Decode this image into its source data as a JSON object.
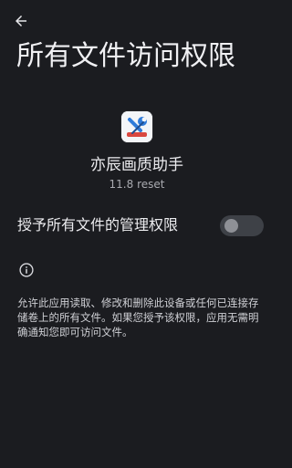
{
  "header": {
    "back_icon": "arrow-back-icon",
    "title": "所有文件访问权限"
  },
  "app": {
    "icon": "wrench-app-icon",
    "name": "亦辰画质助手",
    "version": "11.8 reset"
  },
  "permission": {
    "label": "授予所有文件的管理权限",
    "enabled": false
  },
  "info": {
    "icon": "info-icon",
    "description": "允许此应用读取、修改和删除此设备或任何已连接存储卷上的所有文件。如果您授予该权限，应用无需明确通知您即可访问文件。"
  },
  "colors": {
    "background": "#1b1c20",
    "text_primary": "#ececef",
    "text_secondary": "#a9aab0",
    "switch_track_off": "#3e4147",
    "switch_thumb_off": "#8e9096",
    "app_icon_accent": "#2f7bd9"
  }
}
